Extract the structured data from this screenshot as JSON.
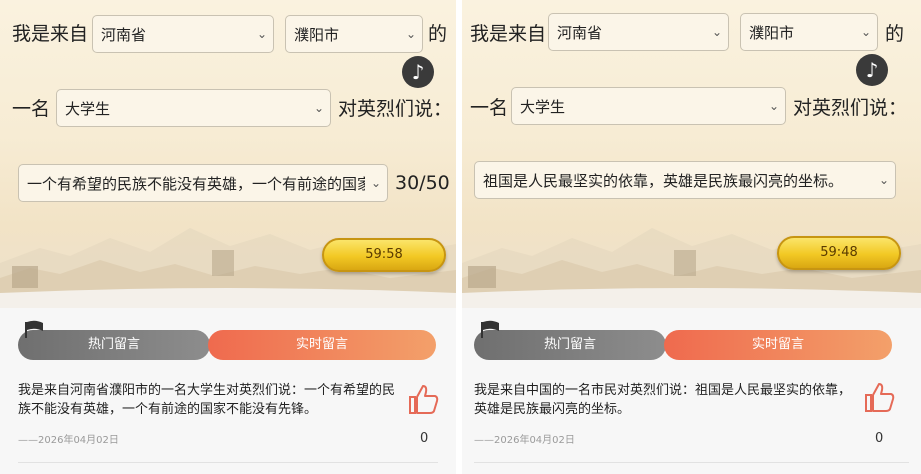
{
  "left": {
    "prefix": "我是来自",
    "province": "河南省",
    "city": "濮阳市",
    "suffix_de": "的",
    "yi_ming": "一名",
    "identity": "大学生",
    "dui_yinglie": "对英烈们说：",
    "message_select": "一个有希望的民族不能没有英雄，一个有前途的国家不能没有先锋。",
    "message_select_visible": "一个有希望的民族不能没有英雄，一个有前途的国家",
    "char_count": "30/50",
    "timer": "59:58",
    "tab_hot": "热门留言",
    "tab_live": "实时留言",
    "comment_text": "我是来自河南省濮阳市的一名大学生对英烈们说：一个有希望的民族不能没有英雄，一个有前途的国家不能没有先锋。",
    "comment_date": "——2026年04月02日",
    "like_count": "0"
  },
  "right": {
    "prefix": "我是来自",
    "province": "河南省",
    "city": "濮阳市",
    "suffix_de": "的",
    "yi_ming": "一名",
    "identity": "大学生",
    "dui_yinglie": "对英烈们说：",
    "message_select": "祖国是人民最坚实的依靠，英雄是民族最闪亮的坐标。",
    "timer": "59:48",
    "tab_hot": "热门留言",
    "tab_live": "实时留言",
    "comment_text": "我是来自中国的一名市民对英烈们说：祖国是人民最坚实的依靠，英雄是民族最闪亮的坐标。",
    "comment_date": "——2026年04月02日",
    "like_count": "0"
  },
  "icons": {
    "music": "music-note-icon",
    "chevron": "chevron-down-icon",
    "thumb": "thumbs-up-icon",
    "flag": "flag-icon"
  }
}
